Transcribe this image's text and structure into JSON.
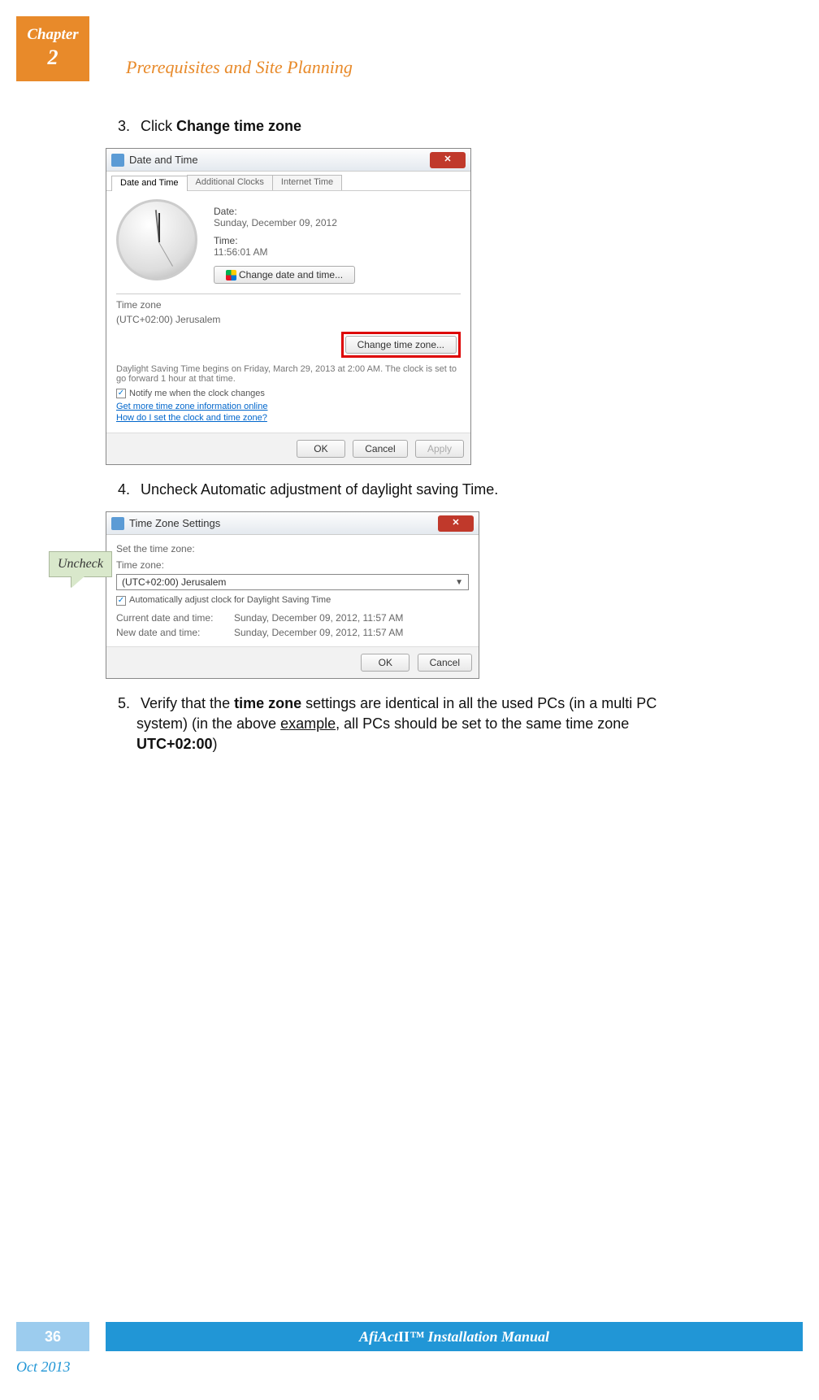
{
  "chapter": {
    "label": "Chapter",
    "number": "2",
    "title": "Prerequisites and Site Planning"
  },
  "steps": {
    "s3": {
      "num": "3.",
      "prefix": "Click ",
      "bold": "Change time zone"
    },
    "s4": {
      "num": "4.",
      "text": "Uncheck Automatic adjustment of daylight saving Time."
    },
    "s5": {
      "num": "5.",
      "p1": "Verify that the ",
      "b1": "time zone",
      "p2": " settings are identical in all the used PCs (in a multi PC ",
      "p3": "system) (in the above ",
      "u1": "example",
      "p4": ", all PCs should be set to the same time zone ",
      "b2": "UTC+02:00",
      "p5": ")"
    }
  },
  "dialog1": {
    "title": "Date and Time",
    "tabs": {
      "t1": "Date and Time",
      "t2": "Additional Clocks",
      "t3": "Internet Time"
    },
    "date_label": "Date:",
    "date_value": "Sunday, December 09, 2012",
    "time_label": "Time:",
    "time_value": "11:56:01 AM",
    "change_dt_btn": "Change date and time...",
    "tz_label": "Time zone",
    "tz_value": "(UTC+02:00) Jerusalem",
    "change_tz_btn": "Change time zone...",
    "dst_text": "Daylight Saving Time begins on Friday, March 29, 2013 at 2:00 AM. The clock is set to go forward 1 hour at that time.",
    "notify_check": "Notify me when the clock changes",
    "link1": "Get more time zone information online",
    "link2": "How do I set the clock and time zone?",
    "ok": "OK",
    "cancel": "Cancel",
    "apply": "Apply"
  },
  "callout": {
    "uncheck": "Uncheck"
  },
  "dialog2": {
    "title": "Time Zone Settings",
    "set_label": "Set the time zone:",
    "tz_label": "Time zone:",
    "tz_value": "(UTC+02:00) Jerusalem",
    "auto_adjust": "Automatically adjust clock for Daylight Saving Time",
    "current_label": "Current date and time:",
    "current_value": "Sunday, December 09, 2012, 11:57 AM",
    "new_label": "New date and time:",
    "new_value": "Sunday, December 09, 2012, 11:57 AM",
    "ok": "OK",
    "cancel": "Cancel"
  },
  "footer": {
    "page": "36",
    "title_pre": "AfiAct ",
    "title_roman": "II",
    "title_post": "™ Installation Manual",
    "date": "Oct 2013"
  }
}
